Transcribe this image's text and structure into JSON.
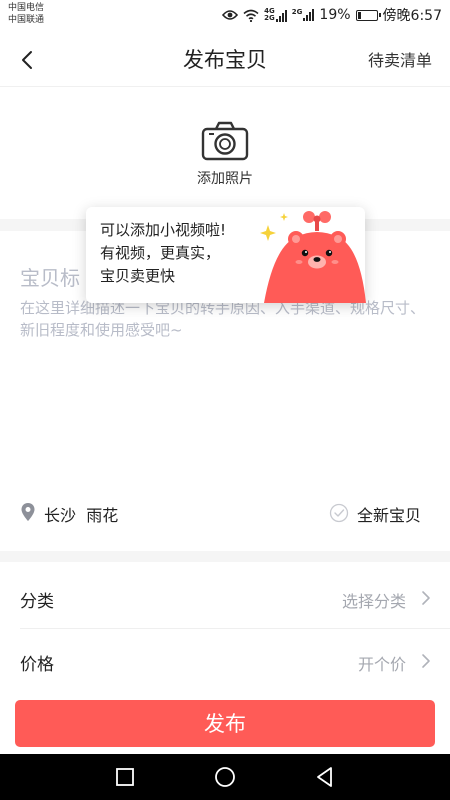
{
  "status_bar": {
    "carrier_1": "中国电信",
    "carrier_2": "中国联通",
    "net_1_top": "4G",
    "net_1_bottom": "2G",
    "net_2_top": "2G",
    "battery_percent": "19%",
    "battery_level": 0.19,
    "time": "傍晚6:57"
  },
  "nav": {
    "back_icon": "chevron-left-icon",
    "title": "发布宝贝",
    "right_action": "待卖清单"
  },
  "photo": {
    "icon": "camera-icon",
    "label": "添加照片"
  },
  "form": {
    "title_placeholder": "宝贝标",
    "description_placeholder": "在这里详细描述一下宝贝的转手原因、入手渠道、规格尺寸、新旧程度和使用感受吧~"
  },
  "tooltip": {
    "lines": [
      "可以添加小视频啦!",
      "有视频，更真实，",
      "宝贝卖更快"
    ],
    "mascot": "red-bear-mascot"
  },
  "location": {
    "city": "长沙",
    "district": "雨花",
    "new_item_label": "全新宝贝"
  },
  "rows": [
    {
      "label": "分类",
      "value": "选择分类"
    },
    {
      "label": "价格",
      "value": "开个价"
    }
  ],
  "publish_button": "发布",
  "colors": {
    "accent": "#ff5b57",
    "placeholder": "#b8bcc8",
    "divider": "#f5f5f5"
  }
}
